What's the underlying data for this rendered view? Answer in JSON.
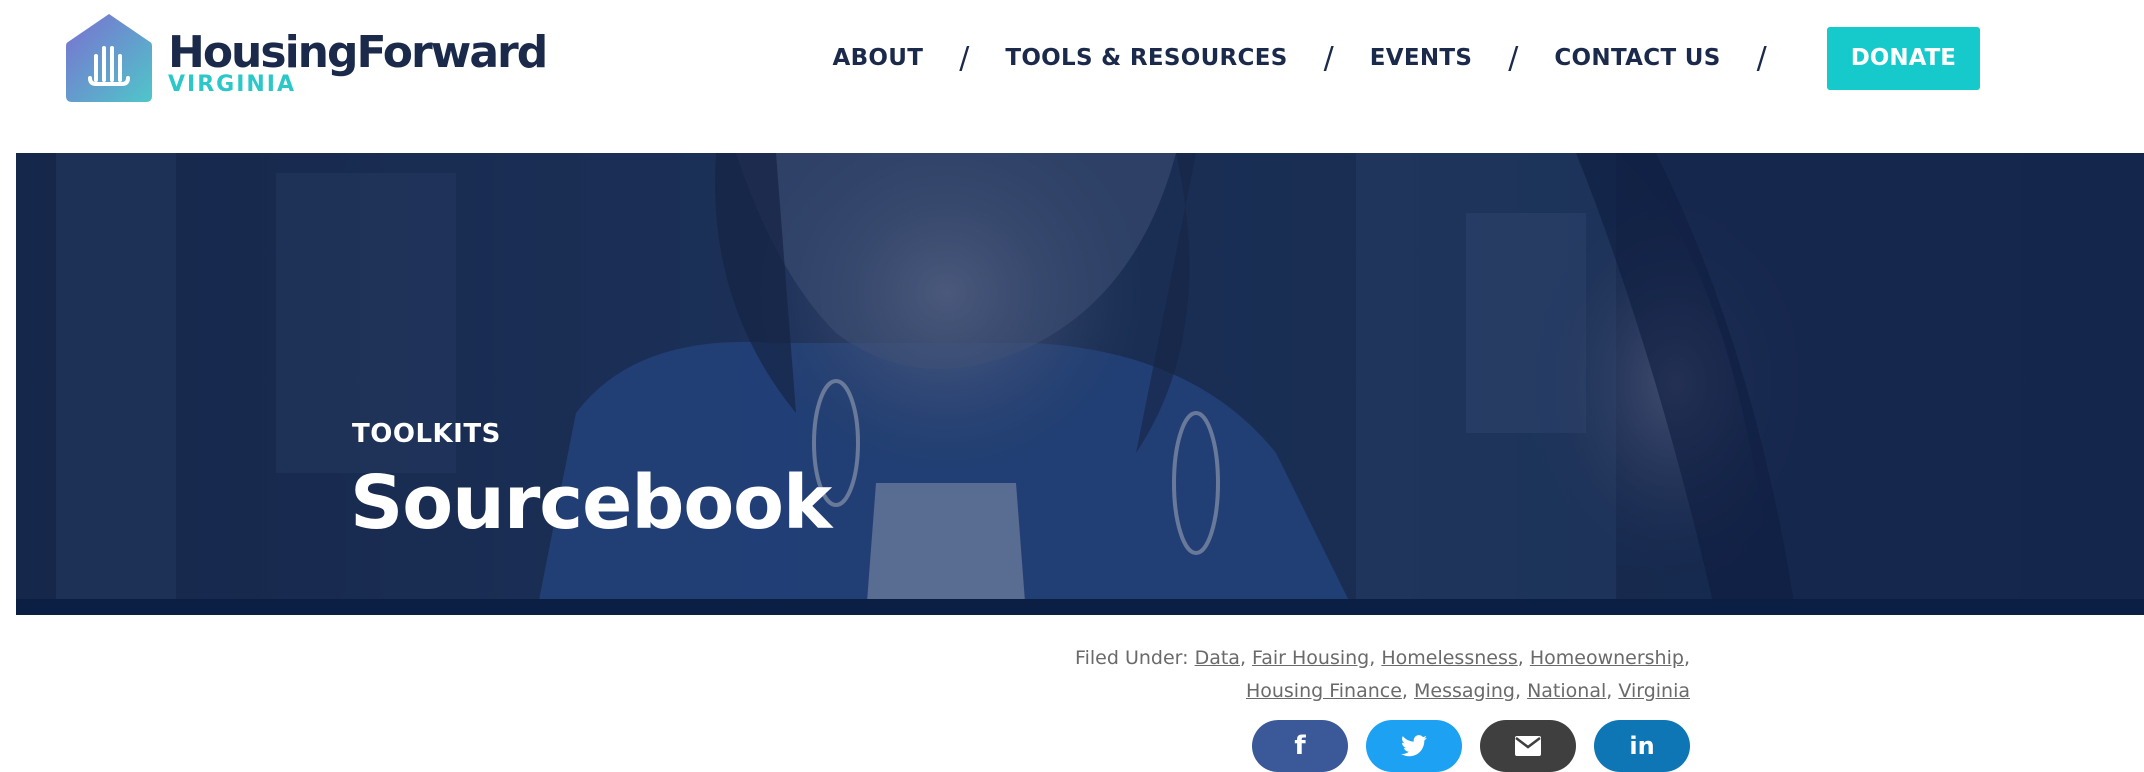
{
  "brand": {
    "name": "HousingForward",
    "region": "VIRGINIA",
    "accent": "#16c9cb",
    "navy": "#1b2a4a"
  },
  "nav": {
    "items": [
      {
        "label": "ABOUT"
      },
      {
        "label": "TOOLS & RESOURCES"
      },
      {
        "label": "EVENTS"
      },
      {
        "label": "CONTACT US"
      }
    ],
    "separator": "/",
    "donate_label": "DONATE"
  },
  "hero": {
    "eyebrow": "TOOLKITS",
    "title": "Sourcebook"
  },
  "filed_under": {
    "prefix": "Filed Under:",
    "tags": [
      "Data",
      "Fair Housing",
      "Homelessness",
      "Homeownership",
      "Housing Finance",
      "Messaging",
      "National",
      "Virginia"
    ]
  },
  "share": {
    "buttons": [
      {
        "icon": "facebook-icon",
        "glyph": "f"
      },
      {
        "icon": "twitter-icon",
        "glyph": ""
      },
      {
        "icon": "email-icon",
        "glyph": ""
      },
      {
        "icon": "linkedin-icon",
        "glyph": "in"
      }
    ]
  }
}
